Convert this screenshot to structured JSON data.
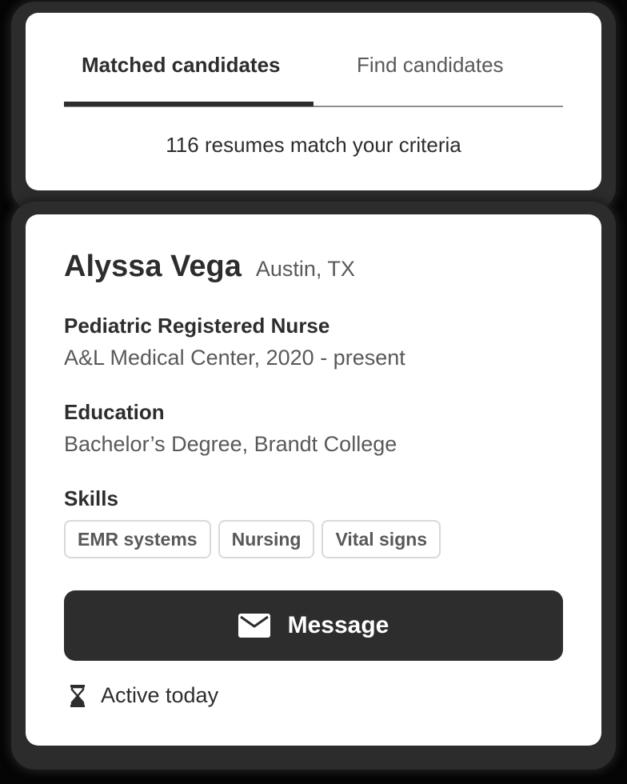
{
  "tabs": {
    "matched_label": "Matched candidates",
    "find_label": "Find candidates"
  },
  "results": {
    "count_text": "116 resumes match your criteria"
  },
  "candidate": {
    "name": "Alyssa Vega",
    "location": "Austin, TX",
    "job_title": "Pediatric Registered Nurse",
    "job_detail": "A&L Medical Center, 2020 - present",
    "education_heading": "Education",
    "education_detail": "Bachelor’s Degree, Brandt College",
    "skills_heading": "Skills",
    "skills": [
      "EMR systems",
      "Nursing",
      "Vital signs"
    ],
    "message_button_label": "Message",
    "message_icon": "mail-icon",
    "activity_icon": "hourglass-icon",
    "activity_status": "Active today"
  },
  "colors": {
    "primary_dark": "#2d2d2d",
    "secondary_text": "#595959",
    "card_background": "#ffffff",
    "chip_border": "#d9d9d9"
  }
}
